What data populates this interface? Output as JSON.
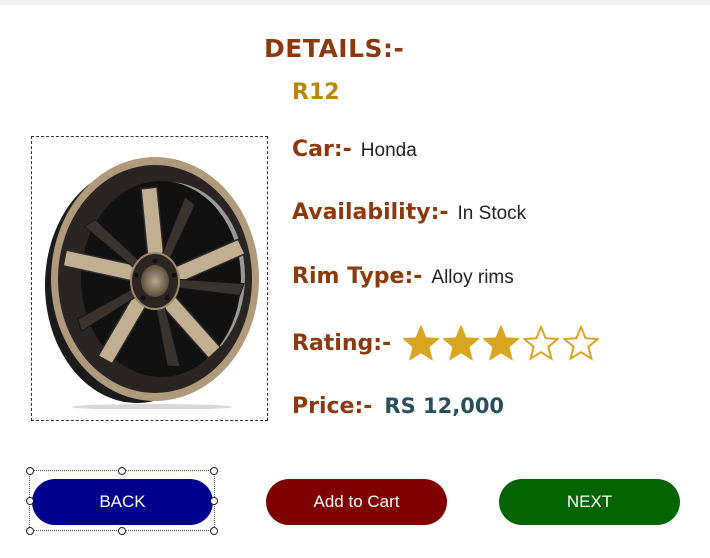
{
  "page": {
    "title": "DETAILS:-",
    "model": "R12"
  },
  "details": {
    "car_label": "Car:-",
    "car_value": "Honda",
    "availability_label": "Availability:-",
    "availability_value": "In Stock",
    "rim_label": "Rim Type:-",
    "rim_value": "Alloy rims",
    "rating_label": "Rating:-",
    "rating_value": 3,
    "rating_max": 5,
    "price_label": "Price:-",
    "price_value": "RS 12,000"
  },
  "buttons": {
    "back": "BACK",
    "add_to_cart": "Add to Cart",
    "next": "NEXT"
  },
  "colors": {
    "label": "#8b3a0f",
    "model": "#b8860b",
    "star": "#daa520",
    "back_button": "#000090",
    "cart_button": "#7f0000",
    "next_button": "#006400"
  },
  "icons": {
    "product": "alloy-wheel-image",
    "rating": "star-icon"
  }
}
